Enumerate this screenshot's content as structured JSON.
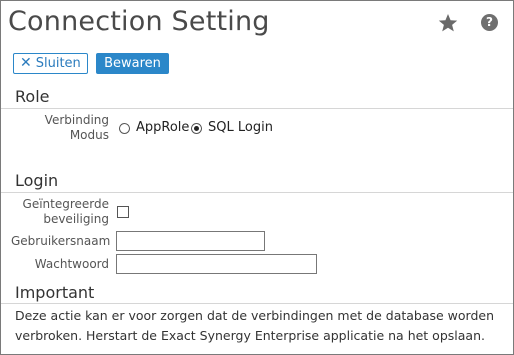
{
  "header": {
    "title": "Connection Setting",
    "icons": [
      "star-icon",
      "help-icon"
    ],
    "help_glyph": "?"
  },
  "toolbar": {
    "close_label": "Sluiten",
    "close_glyph": "✕",
    "save_label": "Bewaren"
  },
  "role": {
    "section_title": "Role",
    "mode_label_line1": "Verbinding",
    "mode_label_line2": "Modus",
    "options": [
      {
        "label": "AppRole",
        "checked": false
      },
      {
        "label": "SQL Login",
        "checked": true
      }
    ]
  },
  "login": {
    "section_title": "Login",
    "integrated_label_line1": "Geïntegreerde",
    "integrated_label_line2": "beveiliging",
    "integrated_checked": false,
    "username_label": "Gebruikersnaam",
    "username_value": "",
    "password_label": "Wachtwoord",
    "password_value": ""
  },
  "important": {
    "section_title": "Important",
    "message": "Deze actie kan er voor zorgen dat de verbindingen met de database worden verbroken. Herstart de Exact Synergy Enterprise applicatie na het opslaan."
  },
  "colors": {
    "accent": "#2b87c9",
    "title_text": "#4a4a4a",
    "divider": "#d6d6d6"
  }
}
